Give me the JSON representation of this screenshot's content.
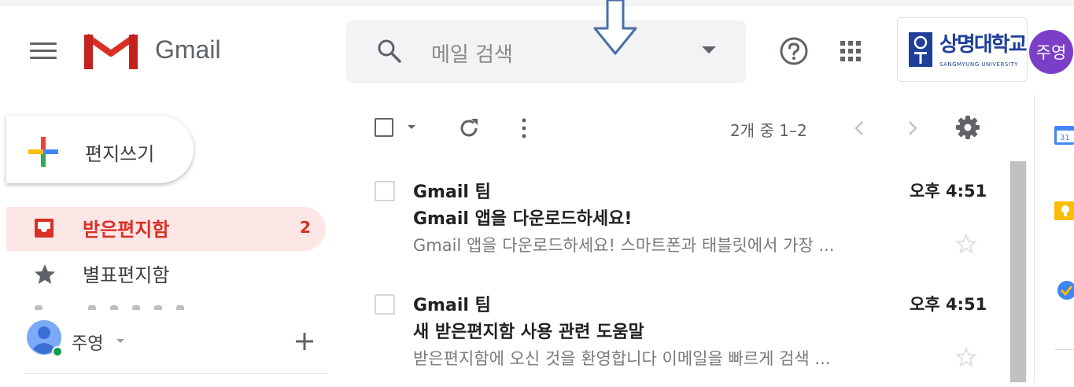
{
  "header": {
    "brand_label": "Gmail",
    "search_placeholder": "메일 검색",
    "university_name": "상명대학교",
    "university_subtitle": "SANGMYUNG UNIVERSITY",
    "account_avatar_initials": "주영"
  },
  "compose": {
    "label": "편지쓰기"
  },
  "sidebar": {
    "items": [
      {
        "label": "받은편지함",
        "count": "2",
        "icon": "inbox-icon",
        "active": true
      },
      {
        "label": "별표편지함",
        "icon": "star-icon"
      }
    ],
    "footer_user_label": "주영"
  },
  "toolbar": {
    "pager_text": "2개 중 1–2"
  },
  "emails": [
    {
      "sender": "Gmail 팀",
      "time": "오후 4:51",
      "subject": "Gmail 앱을 다운로드하세요!",
      "snippet": "Gmail 앱을 다운로드하세요! 스마트폰과 태블릿에서 가장 ..."
    },
    {
      "sender": "Gmail 팀",
      "time": "오후 4:51",
      "subject": "새 받은편지함 사용 관련 도움말",
      "snippet": "받은편지함에 오신 것을 환영합니다 이메일을 빠르게 검색 ..."
    }
  ],
  "colors": {
    "accent_red": "#d93025",
    "inbox_highlight": "#fde6e6",
    "avatar_purple": "#7b3fc7",
    "university_blue": "#1f3f99",
    "annotation_arrow": "#4a6fa5"
  },
  "icons": {
    "menu": "menu-icon",
    "search": "search-icon",
    "help": "help-icon",
    "apps": "apps-grid-icon",
    "settings": "gear-icon",
    "refresh": "refresh-icon",
    "more": "more-vertical-icon",
    "prev": "chevron-left-icon",
    "next": "chevron-right-icon",
    "compose": "plus-icon",
    "star": "star-icon",
    "add": "add-icon",
    "calendar": "calendar-icon",
    "keep": "keep-icon",
    "tasks": "tasks-icon"
  }
}
